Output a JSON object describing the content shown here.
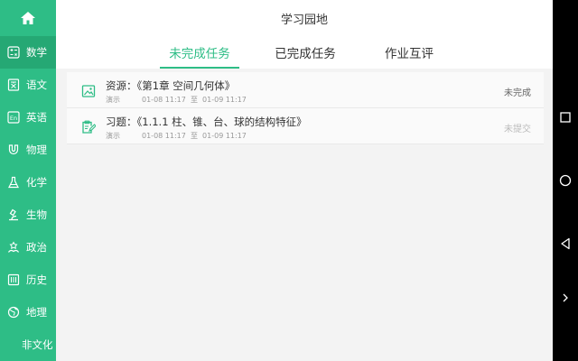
{
  "sidebar": {
    "items": [
      {
        "label": "数学",
        "icon": "math-grid-icon",
        "active": true
      },
      {
        "label": "语文",
        "icon": "chinese-book-icon"
      },
      {
        "label": "英语",
        "icon": "english-en-icon"
      },
      {
        "label": "物理",
        "icon": "magnet-icon"
      },
      {
        "label": "化学",
        "icon": "flask-icon"
      },
      {
        "label": "生物",
        "icon": "microscope-icon"
      },
      {
        "label": "政治",
        "icon": "politics-icon"
      },
      {
        "label": "历史",
        "icon": "history-icon"
      },
      {
        "label": "地理",
        "icon": "globe-icon"
      },
      {
        "label": "非文化",
        "icon": ""
      }
    ]
  },
  "header": {
    "title": "学习园地",
    "tabs": [
      {
        "label": "未完成任务",
        "active": true
      },
      {
        "label": "已完成任务"
      },
      {
        "label": "作业互评"
      }
    ]
  },
  "tasks": [
    {
      "type_label": "资源：",
      "title": "《第1章 空间几何体》",
      "teacher": "演示",
      "start": "01-08 11:17",
      "sep": "至",
      "end": "01-09 11:17",
      "status": "未完成",
      "icon": "image-icon"
    },
    {
      "type_label": "习题：",
      "title": "《1.1.1 柱、锥、台、球的结构特征》",
      "teacher": "演示",
      "start": "01-08 11:17",
      "sep": "至",
      "end": "01-09 11:17",
      "status": "未提交",
      "icon": "exercise-edit-icon"
    }
  ],
  "colors": {
    "accent": "#2ebd86",
    "accent_dark": "#25a874"
  }
}
